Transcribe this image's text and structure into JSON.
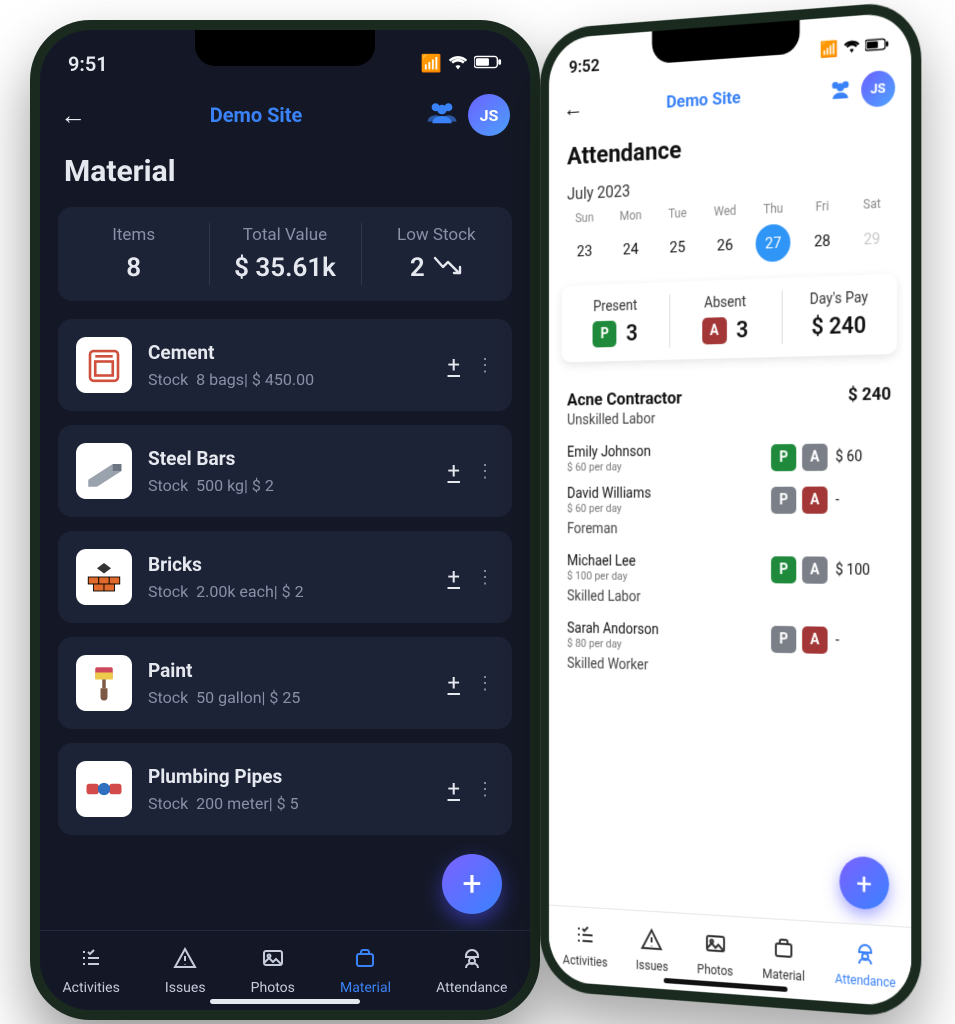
{
  "phone1": {
    "status": {
      "time": "9:51",
      "signal": "▮▮▮▮",
      "wifi": "📶",
      "battery": "🔋"
    },
    "header": {
      "site_label": "Demo Site",
      "avatar_initials": "JS"
    },
    "page_title": "Material",
    "summary": {
      "items": {
        "label": "Items",
        "value": "8"
      },
      "total_value": {
        "label": "Total  Value",
        "value": "$ 35.61k"
      },
      "low_stock": {
        "label": "Low Stock",
        "value": "2"
      }
    },
    "materials": [
      {
        "icon": "cement",
        "name": "Cement",
        "stock_label": "Stock",
        "stock": "8 bags| $ 450.00"
      },
      {
        "icon": "steel",
        "name": "Steel Bars",
        "stock_label": "Stock",
        "stock": "500 kg| $ 2"
      },
      {
        "icon": "bricks",
        "name": "Bricks",
        "stock_label": "Stock",
        "stock": "2.00k each| $ 2"
      },
      {
        "icon": "paint",
        "name": "Paint",
        "stock_label": "Stock",
        "stock": "50 gallon| $ 25"
      },
      {
        "icon": "pipes",
        "name": "Plumbing Pipes",
        "stock_label": "Stock",
        "stock": "200 meter| $ 5"
      }
    ],
    "fab_label": "+",
    "tabs": [
      {
        "label": "Activities",
        "active": false
      },
      {
        "label": "Issues",
        "active": false
      },
      {
        "label": "Photos",
        "active": false
      },
      {
        "label": "Material",
        "active": true
      },
      {
        "label": "Attendance",
        "active": false
      }
    ]
  },
  "phone2": {
    "status": {
      "time": "9:52"
    },
    "header": {
      "site_label": "Demo Site",
      "avatar_initials": "JS"
    },
    "page_title": "Attendance",
    "calendar": {
      "month_label": "July 2023",
      "dows": [
        "Sun",
        "Mon",
        "Tue",
        "Wed",
        "Thu",
        "Fri",
        "Sat"
      ],
      "days": [
        "23",
        "24",
        "25",
        "26",
        "27",
        "28",
        "29"
      ],
      "selected_index": 4,
      "dim_index": 6
    },
    "summary": {
      "present": {
        "label": "Present",
        "value": "3"
      },
      "absent": {
        "label": "Absent",
        "value": "3"
      },
      "days_pay": {
        "label": "Day's Pay",
        "value": "$ 240"
      }
    },
    "contractor": {
      "name": "Acne Contractor",
      "total": "$ 240"
    },
    "groups": [
      {
        "title": "Unskilled Labor",
        "workers": [
          {
            "name": "Emily Johnson",
            "rate": "$ 60 per day",
            "p": "P",
            "a": "gray",
            "amount": "$ 60"
          },
          {
            "name": "David Williams",
            "rate": "$ 60 per day",
            "p": "gray",
            "a": "A",
            "amount": "-"
          }
        ]
      },
      {
        "title": "Foreman",
        "workers": [
          {
            "name": "Michael Lee",
            "rate": "$ 100 per day",
            "p": "P",
            "a": "gray",
            "amount": "$ 100"
          }
        ]
      },
      {
        "title": "Skilled Labor",
        "workers": [
          {
            "name": "Sarah Andorson",
            "rate": "$ 80 per day",
            "p": "gray",
            "a": "A",
            "amount": "-"
          }
        ]
      },
      {
        "title": "Skilled Worker",
        "workers": []
      }
    ],
    "fab_label": "+",
    "tabs": [
      {
        "label": "Activities",
        "active": false
      },
      {
        "label": "Issues",
        "active": false
      },
      {
        "label": "Photos",
        "active": false
      },
      {
        "label": "Material",
        "active": false
      },
      {
        "label": "Attendance",
        "active": true
      }
    ]
  },
  "colors": {
    "accent": "#3a82f7",
    "dark_bg": "#141826",
    "card_bg": "#1d2336"
  }
}
